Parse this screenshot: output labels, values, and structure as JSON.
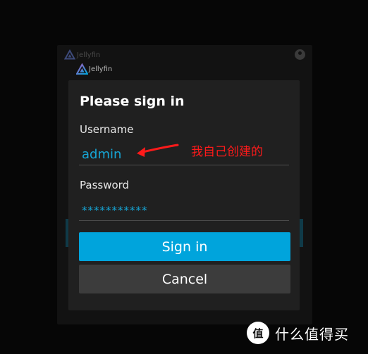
{
  "background": {
    "app_name": "Jellyfin"
  },
  "dialog": {
    "brand": "Jellyfin",
    "title": "Please sign in",
    "username_label": "Username",
    "username_value": "admin",
    "password_label": "Password",
    "password_value": "***********",
    "signin_label": "Sign in",
    "cancel_label": "Cancel"
  },
  "annotation": {
    "text": "我自己创建的",
    "color": "#ff1a1a"
  },
  "watermark": {
    "badge": "值",
    "text": "什么值得买"
  },
  "colors": {
    "accent": "#00a4dc",
    "cancel": "#3c3c3c",
    "dialog_bg": "#202020"
  }
}
